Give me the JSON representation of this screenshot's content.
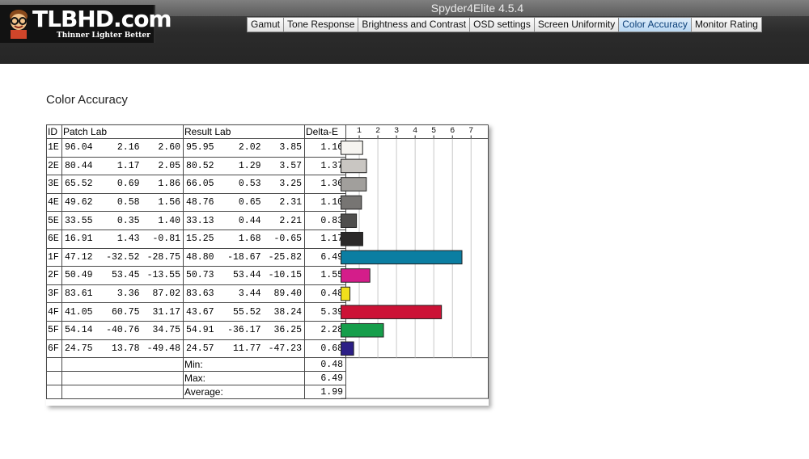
{
  "app": {
    "title": "Spyder4Elite 4.5.4"
  },
  "logo": {
    "text": "TLBHD.com",
    "tagline": "Thinner Lighter Better"
  },
  "tabs": [
    {
      "label": "Gamut",
      "active": false
    },
    {
      "label": "Tone Response",
      "active": false
    },
    {
      "label": "Brightness and Contrast",
      "active": false
    },
    {
      "label": "OSD settings",
      "active": false
    },
    {
      "label": "Screen Uniformity",
      "active": false
    },
    {
      "label": "Color Accuracy",
      "active": true
    },
    {
      "label": "Monitor Rating",
      "active": false
    }
  ],
  "section_title": "Color Accuracy",
  "table": {
    "headers": {
      "id": "ID",
      "patch": "Patch Lab",
      "result": "Result Lab",
      "delta": "Delta-E"
    },
    "rows": [
      {
        "id": "1E",
        "patch": [
          "96.04",
          "2.16",
          "2.60"
        ],
        "result": [
          "95.95",
          "2.02",
          "3.85"
        ],
        "delta": "1.16",
        "color": "#f6f4f0"
      },
      {
        "id": "2E",
        "patch": [
          "80.44",
          "1.17",
          "2.05"
        ],
        "result": [
          "80.52",
          "1.29",
          "3.57"
        ],
        "delta": "1.37",
        "color": "#c9c6c2"
      },
      {
        "id": "3E",
        "patch": [
          "65.52",
          "0.69",
          "1.86"
        ],
        "result": [
          "66.05",
          "0.53",
          "3.25"
        ],
        "delta": "1.36",
        "color": "#a19f9c"
      },
      {
        "id": "4E",
        "patch": [
          "49.62",
          "0.58",
          "1.56"
        ],
        "result": [
          "48.76",
          "0.65",
          "2.31"
        ],
        "delta": "1.10",
        "color": "#777573"
      },
      {
        "id": "5E",
        "patch": [
          "33.55",
          "0.35",
          "1.40"
        ],
        "result": [
          "33.13",
          "0.44",
          "2.21"
        ],
        "delta": "0.83",
        "color": "#4f4e4d"
      },
      {
        "id": "6E",
        "patch": [
          "16.91",
          "1.43",
          "-0.81"
        ],
        "result": [
          "15.25",
          "1.68",
          "-0.65"
        ],
        "delta": "1.17",
        "color": "#2b2929"
      },
      {
        "id": "1F",
        "patch": [
          "47.12",
          "-32.52",
          "-28.75"
        ],
        "result": [
          "48.80",
          "-18.67",
          "-25.82"
        ],
        "delta": "6.49",
        "color": "#0b7ea2"
      },
      {
        "id": "2F",
        "patch": [
          "50.49",
          "53.45",
          "-13.55"
        ],
        "result": [
          "50.73",
          "53.44",
          "-10.15"
        ],
        "delta": "1.55",
        "color": "#d41d8a"
      },
      {
        "id": "3F",
        "patch": [
          "83.61",
          "3.36",
          "87.02"
        ],
        "result": [
          "83.63",
          "3.44",
          "89.40"
        ],
        "delta": "0.48",
        "color": "#f1df1c"
      },
      {
        "id": "4F",
        "patch": [
          "41.05",
          "60.75",
          "31.17"
        ],
        "result": [
          "43.67",
          "55.52",
          "38.24"
        ],
        "delta": "5.39",
        "color": "#cc1236"
      },
      {
        "id": "5F",
        "patch": [
          "54.14",
          "-40.76",
          "34.75"
        ],
        "result": [
          "54.91",
          "-36.17",
          "36.25"
        ],
        "delta": "2.28",
        "color": "#169e4b"
      },
      {
        "id": "6F",
        "patch": [
          "24.75",
          "13.78",
          "-49.48"
        ],
        "result": [
          "24.57",
          "11.77",
          "-47.23"
        ],
        "delta": "0.68",
        "color": "#2c1f86"
      }
    ],
    "summary": [
      {
        "label": "Min:",
        "value": "0.48"
      },
      {
        "label": "Max:",
        "value": "6.49"
      },
      {
        "label": "Average:",
        "value": "1.99"
      }
    ]
  },
  "chart_data": {
    "type": "bar",
    "ticks": [
      "1",
      "2",
      "3",
      "4",
      "5",
      "6",
      "7"
    ],
    "xlim": [
      0,
      7.9
    ],
    "categories": [
      "1E",
      "2E",
      "3E",
      "4E",
      "5E",
      "6E",
      "1F",
      "2F",
      "3F",
      "4F",
      "5F",
      "6F"
    ],
    "values": [
      1.16,
      1.37,
      1.36,
      1.1,
      0.83,
      1.17,
      6.49,
      1.55,
      0.48,
      5.39,
      2.28,
      0.68
    ]
  }
}
